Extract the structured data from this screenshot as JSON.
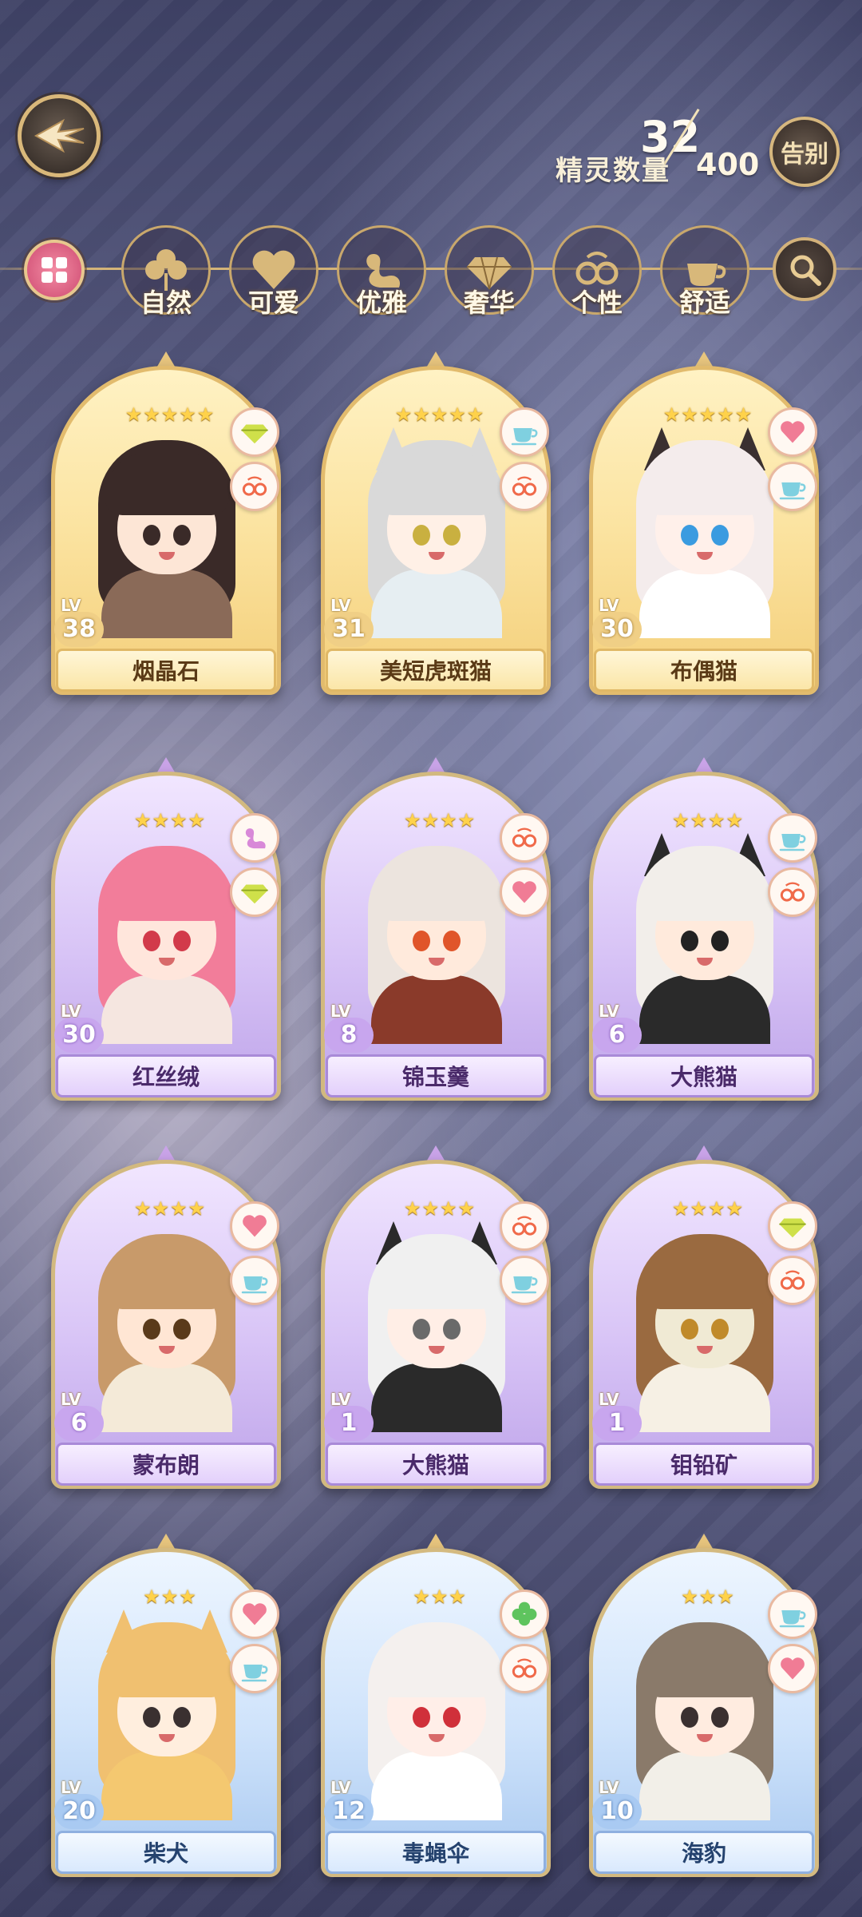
{
  "header": {
    "spirit_count_label": "精灵数量",
    "spirit_count": "32",
    "spirit_capacity": "400",
    "farewell_label": "告别"
  },
  "filters": [
    {
      "label": "自然",
      "icon": "clover-icon"
    },
    {
      "label": "可爱",
      "icon": "heart-icon"
    },
    {
      "label": "优雅",
      "icon": "swan-icon"
    },
    {
      "label": "奢华",
      "icon": "diamond-icon"
    },
    {
      "label": "个性",
      "icon": "glasses-icon"
    },
    {
      "label": "舒适",
      "icon": "teacup-icon"
    }
  ],
  "cards": [
    {
      "name": "烟晶石",
      "lv_label": "LV",
      "level": "38",
      "stars": "★★★★★",
      "rarity": "gold",
      "tags": [
        "diamond-icon",
        "glasses-icon"
      ]
    },
    {
      "name": "美短虎斑猫",
      "lv_label": "LV",
      "level": "31",
      "stars": "★★★★★",
      "rarity": "gold",
      "tags": [
        "teacup-icon",
        "glasses-icon"
      ]
    },
    {
      "name": "布偶猫",
      "lv_label": "LV",
      "level": "30",
      "stars": "★★★★★",
      "rarity": "gold",
      "tags": [
        "heart-icon",
        "teacup-icon"
      ]
    },
    {
      "name": "红丝绒",
      "lv_label": "LV",
      "level": "30",
      "stars": "★★★★",
      "rarity": "purple",
      "tags": [
        "swan-icon",
        "diamond-icon"
      ]
    },
    {
      "name": "锦玉羹",
      "lv_label": "LV",
      "level": "8",
      "stars": "★★★★",
      "rarity": "purple",
      "tags": [
        "glasses-icon",
        "heart-icon"
      ]
    },
    {
      "name": "大熊猫",
      "lv_label": "LV",
      "level": "6",
      "stars": "★★★★",
      "rarity": "purple",
      "tags": [
        "teacup-icon",
        "glasses-icon"
      ]
    },
    {
      "name": "蒙布朗",
      "lv_label": "LV",
      "level": "6",
      "stars": "★★★★",
      "rarity": "purple",
      "tags": [
        "heart-icon",
        "teacup-icon"
      ]
    },
    {
      "name": "大熊猫",
      "lv_label": "LV",
      "level": "1",
      "stars": "★★★★",
      "rarity": "purple",
      "tags": [
        "glasses-icon",
        "teacup-icon"
      ]
    },
    {
      "name": "钼铅矿",
      "lv_label": "LV",
      "level": "1",
      "stars": "★★★★",
      "rarity": "purple",
      "tags": [
        "diamond-icon",
        "glasses-icon"
      ]
    },
    {
      "name": "柴犬",
      "lv_label": "LV",
      "level": "20",
      "stars": "★★★",
      "rarity": "blue",
      "tags": [
        "heart-icon",
        "teacup-icon"
      ]
    },
    {
      "name": "毒蝇伞",
      "lv_label": "LV",
      "level": "12",
      "stars": "★★★",
      "rarity": "blue",
      "tags": [
        "clover-icon",
        "glasses-icon"
      ]
    },
    {
      "name": "海豹",
      "lv_label": "LV",
      "level": "10",
      "stars": "★★★",
      "rarity": "blue",
      "tags": [
        "teacup-icon",
        "heart-icon"
      ]
    }
  ],
  "colors": {
    "gold_frame": "#e2bb6d",
    "purple_frame": "#d2b97f",
    "blue_frame": "#d4ba80",
    "accent_gold": "#d4b478"
  }
}
